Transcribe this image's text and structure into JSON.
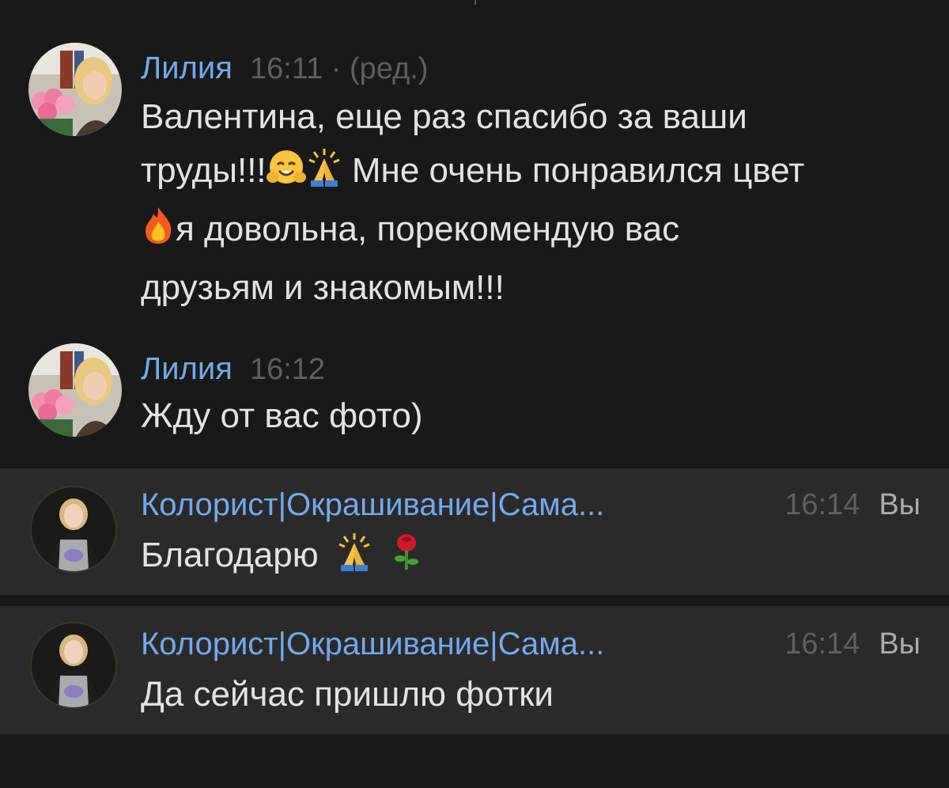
{
  "messages": [
    {
      "author": "Лилия",
      "time": "16:11",
      "edited": "· (ред.)",
      "text_1": "Валентина, еще раз спасибо за ваши",
      "text_2a": "труды!!!",
      "text_2b": " Мне очень понравился цвет",
      "text_3": "я довольна, порекомендую вас",
      "text_4": "друзьям и знакомым!!!"
    },
    {
      "author": "Лилия",
      "time": "16:12",
      "text": "Жду от вас фото)"
    },
    {
      "author": "Колорист|Окрашивание|Сама...",
      "time": "16:14",
      "you": "Вы",
      "text": "Благодарю"
    },
    {
      "author": "Колорист|Окрашивание|Сама...",
      "time": "16:14",
      "you": "Вы",
      "text": "Да сейчас пришлю фотки"
    }
  ],
  "icons": [
    "hugging-face-emoji",
    "folded-hands-emoji",
    "fire-emoji",
    "rose-emoji"
  ],
  "colors": {
    "background": "#191919",
    "own_message_bg": "#2a2a2b",
    "author": "#71aaeb",
    "text": "#e1e3e6",
    "meta": "#5d5f61"
  }
}
